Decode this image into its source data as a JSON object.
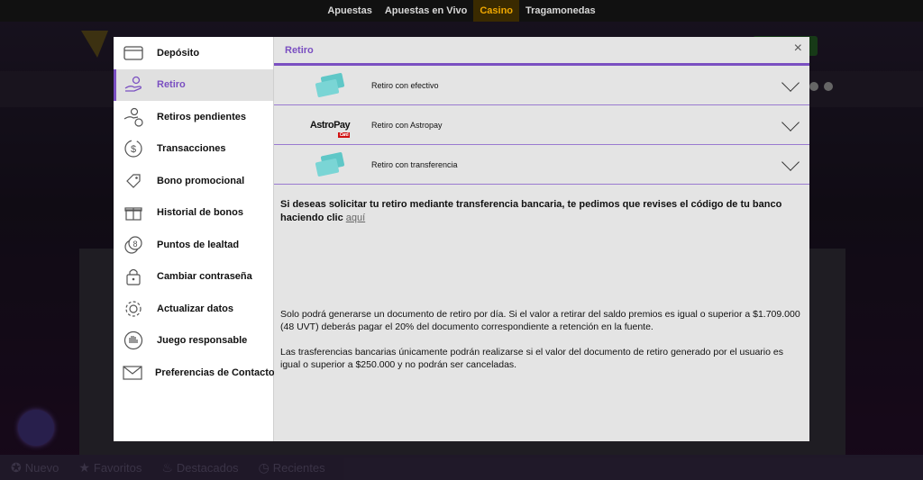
{
  "topnav": {
    "items": [
      {
        "label": "Apuestas",
        "active": false
      },
      {
        "label": "Apuestas en Vivo",
        "active": false
      },
      {
        "label": "Casino",
        "active": true
      },
      {
        "label": "Tragamonedas",
        "active": false
      }
    ]
  },
  "bottombar": {
    "items": [
      {
        "label": "Nuevo",
        "icon": "new-icon"
      },
      {
        "label": "Favoritos",
        "icon": "star-icon"
      },
      {
        "label": "Destacados",
        "icon": "fire-icon"
      },
      {
        "label": "Recientes",
        "icon": "clock-icon"
      }
    ]
  },
  "sidebar": {
    "items": [
      {
        "label": "Depósito",
        "icon": "card-icon"
      },
      {
        "label": "Retiro",
        "icon": "hand-coin-icon",
        "active": true
      },
      {
        "label": "Retiros pendientes",
        "icon": "hand-clock-icon"
      },
      {
        "label": "Transacciones",
        "icon": "dollar-cycle-icon"
      },
      {
        "label": "Bono promocional",
        "icon": "tag-icon"
      },
      {
        "label": "Historial de bonos",
        "icon": "gift-icon"
      },
      {
        "label": "Puntos de lealtad",
        "icon": "coins-icon"
      },
      {
        "label": "Cambiar contraseña",
        "icon": "lock-icon"
      },
      {
        "label": "Actualizar datos",
        "icon": "gear-icon"
      },
      {
        "label": "Juego responsable",
        "icon": "hand-stop-icon"
      },
      {
        "label": "Preferencias de Contacto",
        "icon": "mail-icon"
      }
    ]
  },
  "content": {
    "title": "Retiro",
    "close": "×",
    "methods": [
      {
        "label": "Retiro con efectivo",
        "logo": "cards-logo"
      },
      {
        "label": "Retiro con Astropay",
        "logo": "astropay-logo"
      },
      {
        "label": "Retiro con transferencia",
        "logo": "cards-logo"
      }
    ],
    "astropay_logo": "AstroPay",
    "astropay_badge": "Card",
    "lead_text": "Si deseas solicitar tu retiro mediante transferencia bancaria, te pedimos que revises el código de tu banco haciendo clic",
    "lead_link": "aquí",
    "paragraph1": "Solo podrá generarse un documento de retiro por día. Si el valor a retirar del saldo premios es igual o superior a $1.709.000 (48 UVT) deberás pagar el 20% del documento correspondiente a retención en la fuente.",
    "paragraph2": "Las trasferencias bancarias únicamente podrán realizarse si el valor del documento de retiro generado por el usuario es igual o superior a $250.000 y no podrán ser canceladas."
  }
}
